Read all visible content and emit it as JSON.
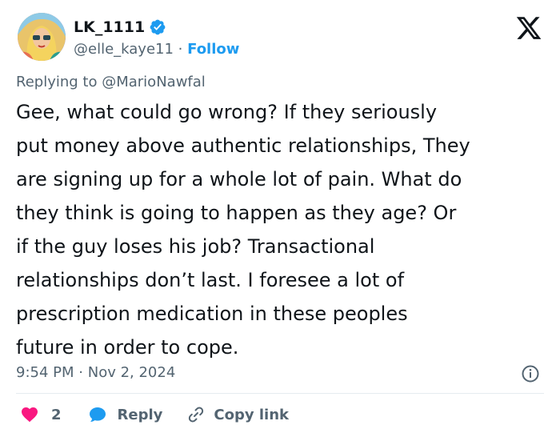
{
  "author": {
    "display_name": "LK_1111",
    "handle": "@elle_kaye11",
    "separator": "·",
    "follow_label": "Follow"
  },
  "post": {
    "replying_prefix": "Replying to",
    "replying_to": "@MarioNawfal",
    "text": "Gee, what could go wrong? If they seriously\nput money above authentic relationships, They\nare signing up for a whole lot of pain. What do\nthey think is going to happen as they age? Or\nif the guy loses his job? Transactional\nrelationships don’t last. I foresee a lot of\nprescription medication in these peoples\nfuture in order to cope.",
    "time": "9:54 PM",
    "date": "Nov 2, 2024",
    "meta_separator": "·"
  },
  "actions": {
    "like_count": "2",
    "reply_label": "Reply",
    "copy_label": "Copy link"
  },
  "colors": {
    "accent": "#1d9bf0",
    "like": "#f91880",
    "text": "#0f1419",
    "muted": "#536471"
  },
  "icons": [
    "verified-badge-icon",
    "x-logo-icon",
    "info-icon",
    "heart-icon",
    "reply-bubble-icon",
    "link-icon"
  ]
}
